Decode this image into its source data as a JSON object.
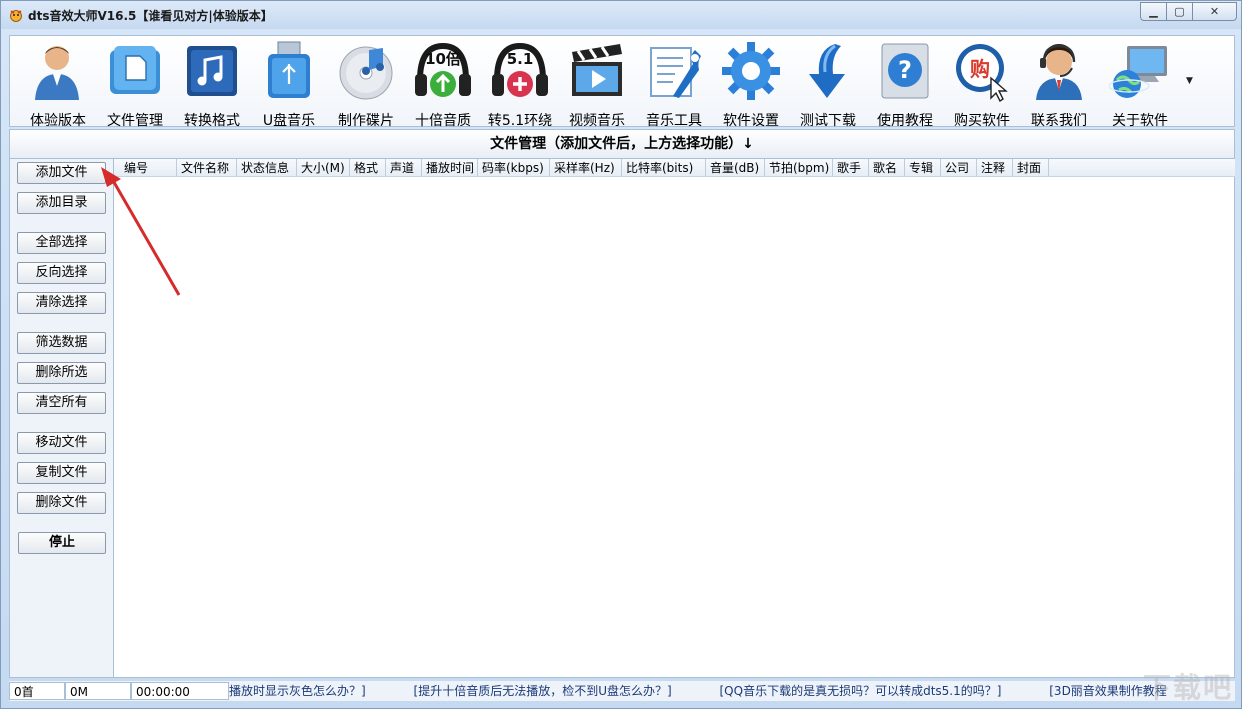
{
  "window": {
    "title": "dts音效大师V16.5【谁看见对方|体验版本】"
  },
  "toolbar": {
    "items": [
      {
        "label": "体验版本",
        "icon": "user-icon"
      },
      {
        "label": "文件管理",
        "icon": "folder-icon"
      },
      {
        "label": "转换格式",
        "icon": "music-note-icon"
      },
      {
        "label": "U盘音乐",
        "icon": "usb-drive-icon"
      },
      {
        "label": "制作碟片",
        "icon": "cd-icon"
      },
      {
        "label": "十倍音质",
        "icon": "headphones-10x-icon",
        "badge": "10倍"
      },
      {
        "label": "转5.1环绕",
        "icon": "headphones-51-icon",
        "badge": "5.1"
      },
      {
        "label": "视频音乐",
        "icon": "clapperboard-icon"
      },
      {
        "label": "音乐工具",
        "icon": "tools-icon"
      },
      {
        "label": "软件设置",
        "icon": "gear-icon"
      },
      {
        "label": "测试下载",
        "icon": "download-arrow-icon"
      },
      {
        "label": "使用教程",
        "icon": "help-icon"
      },
      {
        "label": "购买软件",
        "icon": "buy-icon",
        "badge": "购"
      },
      {
        "label": "联系我们",
        "icon": "support-agent-icon"
      },
      {
        "label": "关于软件",
        "icon": "computer-globe-icon"
      }
    ]
  },
  "panel": {
    "header": "文件管理（添加文件后，上方选择功能）↓"
  },
  "sidebar": {
    "buttons": [
      {
        "label": "添加文件"
      },
      {
        "label": "添加目录"
      },
      {
        "label": "全部选择"
      },
      {
        "label": "反向选择"
      },
      {
        "label": "清除选择"
      },
      {
        "label": "筛选数据"
      },
      {
        "label": "删除所选"
      },
      {
        "label": "清空所有"
      },
      {
        "label": "移动文件"
      },
      {
        "label": "复制文件"
      },
      {
        "label": "删除文件"
      },
      {
        "label": "停止"
      }
    ]
  },
  "table": {
    "columns": [
      "编号",
      "文件名称",
      "状态信息",
      "大小(M)",
      "格式",
      "声道",
      "播放时间",
      "码率(kbps)",
      "采样率(Hz)",
      "比特率(bits)",
      "音量(dB)",
      "节拍(bpm)",
      "歌手",
      "歌名",
      "专辑",
      "公司",
      "注释",
      "封面"
    ]
  },
  "status": {
    "count": "0首",
    "size": "0M",
    "time": "00:00:00",
    "tips": [
      "播放时显示灰色怎么办？]",
      "[提升十倍音质后无法播放，检不到U盘怎么办？]",
      "[QQ音乐下载的是真无损吗？可以转成dts5.1的吗？]",
      "[3D丽音效果制作教程"
    ]
  },
  "watermark": "下载吧",
  "colors": {
    "frame": "#c5d9f1",
    "border": "#a9bfd6",
    "annotation_arrow": "#d62b2b"
  }
}
